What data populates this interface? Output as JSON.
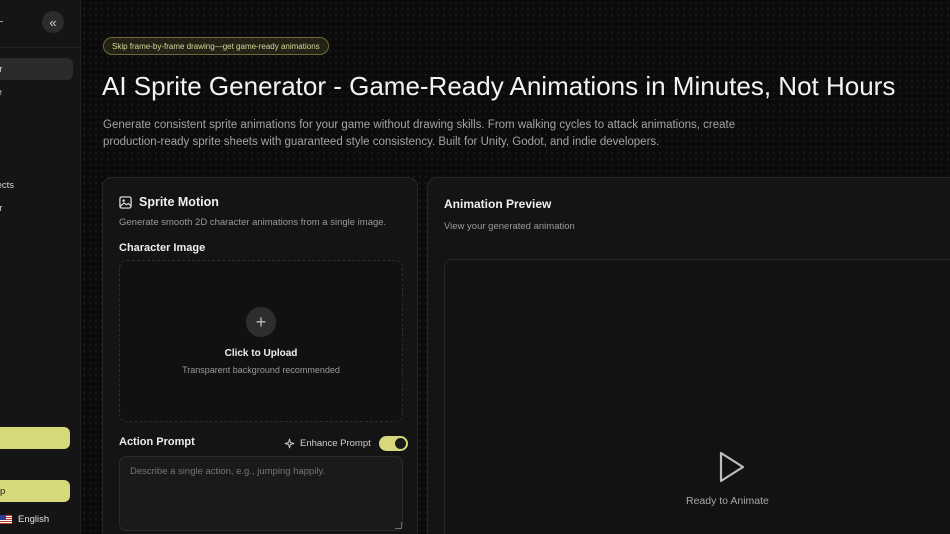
{
  "sidebar": {
    "collapse_icon": "«",
    "items": [
      {
        "label": "Sprite Generator",
        "visible_fragment": "or",
        "active": true
      },
      {
        "label": "Sprite Sheet Template",
        "visible_fragment": "te",
        "active": false
      },
      {
        "label": "Visual Effects",
        "visible_fragment": "fects",
        "active": false
      },
      {
        "label": "Video Editor",
        "visible_fragment": "or",
        "active": false
      }
    ],
    "buttons": [
      {
        "label": ""
      },
      {
        "label": "p"
      }
    ],
    "language": {
      "label": "English",
      "flag_icon": "us-flag-icon"
    },
    "accent_color": "#d7d77b"
  },
  "header": {
    "badge": "Skip frame-by-frame drawing—get game-ready animations",
    "title": "AI Sprite Generator - Game-Ready Animations in Minutes, Not Hours",
    "subtitle": "Generate consistent sprite animations for your game without drawing skills. From walking cycles to attack animations, create production-ready sprite sheets with guaranteed style consistency. Built for Unity, Godot, and indie developers."
  },
  "sprite_motion": {
    "title": "Sprite Motion",
    "icon": "image-icon",
    "description": "Generate smooth 2D character animations from a single image.",
    "character_image_label": "Character Image",
    "upload_title": "Click to Upload",
    "upload_hint": "Transparent background recommended",
    "action_prompt_label": "Action Prompt",
    "enhance_prompt_label": "Enhance Prompt",
    "enhance_prompt_enabled": true,
    "prompt_placeholder": "Describe a single action, e.g., jumping happily."
  },
  "preview": {
    "title": "Animation Preview",
    "description": "View your generated animation",
    "status": "Ready to Animate",
    "icon": "play-icon"
  }
}
